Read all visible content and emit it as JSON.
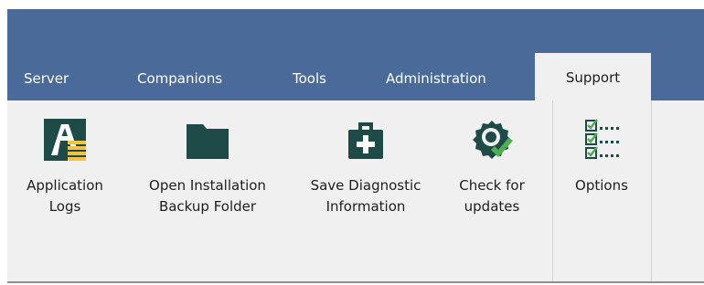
{
  "tabs": [
    {
      "label": "Server"
    },
    {
      "label": "Companions"
    },
    {
      "label": "Tools"
    },
    {
      "label": "Administration"
    },
    {
      "label": "Support",
      "active": true
    }
  ],
  "ribbon": {
    "buttons": [
      {
        "label": "Application\nLogs",
        "icon": "application-logs-icon"
      },
      {
        "label": "Open Installation\nBackup Folder",
        "icon": "folder-icon"
      },
      {
        "label": "Save Diagnostic\nInformation",
        "icon": "first-aid-kit-icon"
      },
      {
        "label": "Check for\nupdates",
        "icon": "update-badge-icon"
      },
      {
        "label": "Options",
        "icon": "checklist-icon"
      }
    ]
  },
  "colors": {
    "title_bar": "#4a6a9a",
    "ribbon_bg": "#f0f0f0",
    "icon_dark": "#1e4a47",
    "accent_green": "#4caf50",
    "accent_yellow": "#f5c242"
  }
}
